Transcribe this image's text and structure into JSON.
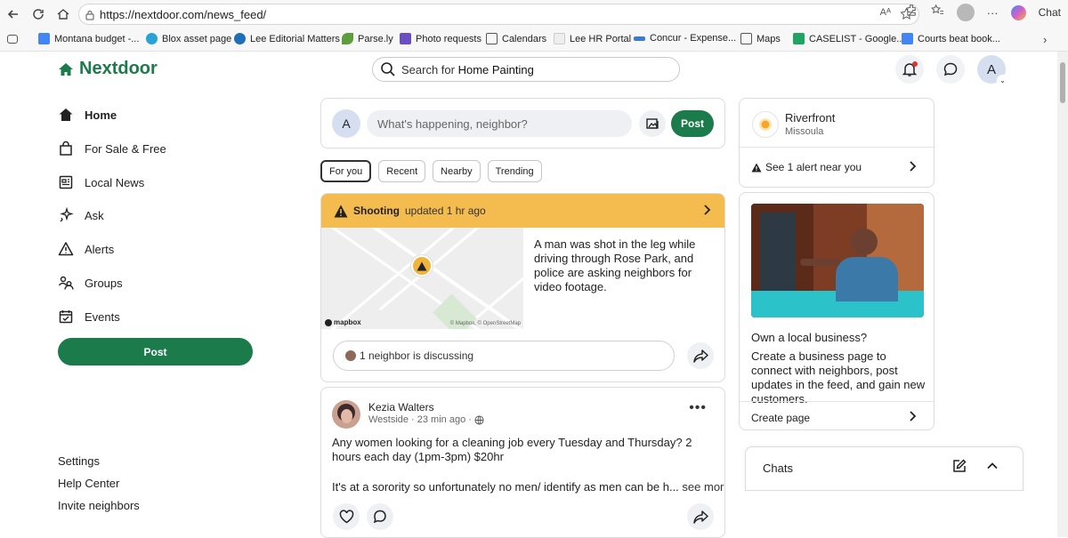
{
  "browser": {
    "url": "https://nextdoor.com/news_feed/",
    "chat_label": "Chat",
    "bookmarks": [
      {
        "label": "Montana budget -...",
        "color": "#4285f4"
      },
      {
        "label": "Blox asset page",
        "color": "#29a3d6"
      },
      {
        "label": "Lee Editorial Matters",
        "color": "#1e6fb8"
      },
      {
        "label": "Parse.ly",
        "color": "#5c9e3c"
      },
      {
        "label": "Photo requests",
        "color": "#6a4fc4"
      },
      {
        "label": "Calendars",
        "color": "#555555"
      },
      {
        "label": "Lee HR Portal",
        "color": "#cccccc"
      },
      {
        "label": "Concur - Expense...",
        "color": "#3a7bd5"
      },
      {
        "label": "Maps",
        "color": "#555555"
      },
      {
        "label": "CASELIST - Google...",
        "color": "#1fa463"
      },
      {
        "label": "Courts beat book...",
        "color": "#4285f4"
      }
    ]
  },
  "header": {
    "logo": "Nextdoor",
    "search_prefix": "Search for ",
    "search_term": "Home Painting",
    "avatar_initial": "A"
  },
  "sidebar": {
    "items": [
      {
        "label": "Home"
      },
      {
        "label": "For Sale & Free"
      },
      {
        "label": "Local News"
      },
      {
        "label": "Ask"
      },
      {
        "label": "Alerts"
      },
      {
        "label": "Groups"
      },
      {
        "label": "Events"
      }
    ],
    "post_label": "Post",
    "footer": [
      "Settings",
      "Help Center",
      "Invite neighbors"
    ]
  },
  "composer": {
    "avatar_initial": "A",
    "placeholder": "What's happening, neighbor?",
    "post_label": "Post"
  },
  "filters": [
    "For you",
    "Recent",
    "Nearby",
    "Trending"
  ],
  "alert": {
    "type": "Shooting",
    "updated": "updated 1 hr ago",
    "text": "A man was shot in the leg while driving through Rose Park, and police are asking neighbors for video footage.",
    "discussing": "1 neighbor is discussing",
    "map_brand": "mapbox",
    "map_copyright": "© Mapbox, © OpenStreetMap"
  },
  "post": {
    "author": "Kezia Walters",
    "neighborhood": "Westside",
    "time": "· 23 min ago ·",
    "body": "Any women looking for a cleaning job every Tuesday and Thursday? 2 hours each day (1pm-3pm) $20hr",
    "body2": "It's at a sorority so unfortunately no men/ identify as men can be h...",
    "see_more": "see more"
  },
  "location": {
    "name": "Riverfront",
    "city": "Missoula",
    "alert_text": "See 1 alert near you"
  },
  "business": {
    "title": "Own a local business?",
    "text": "Create a business page to connect with neighbors, post updates in the feed, and gain new customers.",
    "link": "Create page"
  },
  "chats": {
    "title": "Chats"
  },
  "colors": {
    "brand_green": "#1b7b4b",
    "alert_yellow": "#f4bb4f"
  }
}
